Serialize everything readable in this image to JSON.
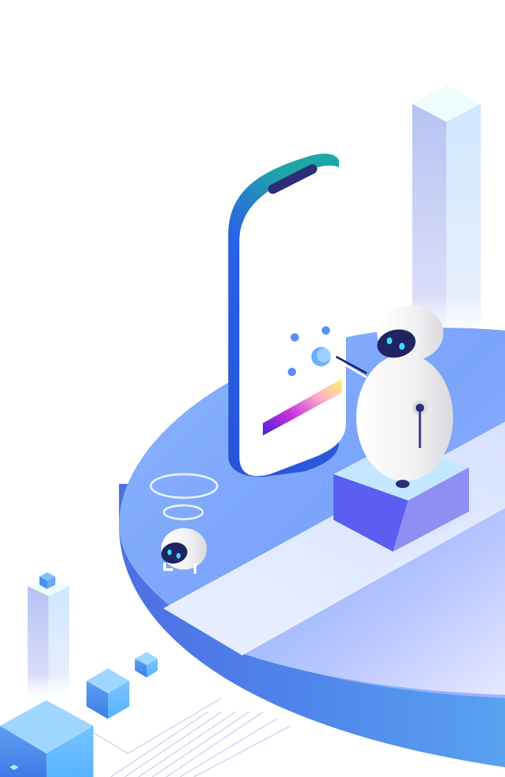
{
  "illustration": {
    "subject": "isometric-robot-mobile-scene",
    "colors": {
      "background": "#ffffff",
      "platform_top_light": "#8fb4ff",
      "platform_top_mid": "#6f9dfb",
      "platform_side_dark": "#4a6fe0",
      "platform_side_light": "#5aa8f0",
      "phone_frame": "#2a5be0",
      "phone_notch": "#2b2f7a",
      "robot_body": "#f3f3f3",
      "robot_visor": "#202463",
      "robot_eyes": "#35e3ff",
      "pedestal_side_left": "#5b5ef0",
      "pedestal_side_right": "#8c8cf2",
      "pedestal_top": "#bfe4ff",
      "pillar_top": "#e6fbff",
      "cube_light": "#9fd6ff",
      "cube_dark": "#4f8cf0"
    },
    "icons": [
      "robot",
      "mobile-phone",
      "touch-dot",
      "gradient-bar",
      "cube",
      "pillar"
    ]
  }
}
